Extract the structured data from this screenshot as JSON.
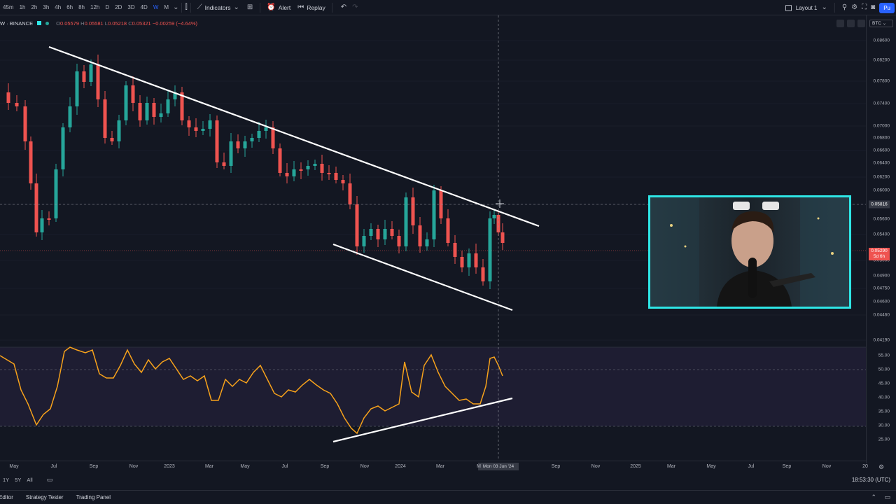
{
  "toolbar": {
    "intervals": [
      "45m",
      "1h",
      "2h",
      "3h",
      "4h",
      "6h",
      "8h",
      "12h",
      "D",
      "2D",
      "3D",
      "4D",
      "W",
      "M"
    ],
    "active_interval": "W",
    "indicators_label": "Indicators",
    "alert_label": "Alert",
    "replay_label": "Replay",
    "layout_label": "Layout 1",
    "publish_label": "Pu"
  },
  "legend": {
    "symbol": "W · BINANCE",
    "open_label": "O",
    "open": "0.05579",
    "high_label": "H",
    "high": "0.05581",
    "low_label": "L",
    "low": "0.05218",
    "close_label": "C",
    "close": "0.05321",
    "change": "−0.00259 (−4.64%)"
  },
  "currency_badge": "BTC",
  "price_axis": {
    "labels": [
      "0.08600",
      "0.08200",
      "0.07800",
      "0.07400",
      "0.07000",
      "0.06800",
      "0.06600",
      "0.06400",
      "0.06200",
      "0.06000",
      "0.05600",
      "0.05400",
      "0.05000",
      "0.04900",
      "0.04750",
      "0.04600",
      "0.04460",
      "0.04190"
    ],
    "crosshair_price": "0.05816",
    "last_price": "0.05290",
    "last_price_countdown": "5d 6h"
  },
  "rsi_axis": {
    "labels": [
      "55.00",
      "50.00",
      "45.00",
      "40.00",
      "35.00",
      "30.00",
      "25.00"
    ]
  },
  "time_axis": {
    "labels": [
      "May",
      "Jul",
      "Sep",
      "Nov",
      "2023",
      "Mar",
      "May",
      "Jul",
      "Sep",
      "Nov",
      "2024",
      "Mar",
      "M",
      "Sep",
      "Nov",
      "2025",
      "Mar",
      "May",
      "Jul",
      "Sep",
      "Nov",
      "20"
    ],
    "cursor_label": "Mon 03 Jun '24"
  },
  "range_bar": {
    "ranges": [
      "1Y",
      "5Y",
      "All"
    ],
    "clock": "18:53:30 (UTC)"
  },
  "bottom_bar": {
    "tabs": [
      "Editor",
      "Strategy Tester",
      "Trading Panel"
    ]
  },
  "colors": {
    "bull": "#26a69a",
    "bear": "#ef5350",
    "rsi": "#f7a21b",
    "trendline": "#ffffff",
    "rsi_band": "#7e57c2",
    "webcam_border": "#2ee6e6",
    "accent": "#2962ff"
  },
  "icons": {
    "bar-type": "bar-type-icon",
    "indicators": "indicators-icon",
    "templates": "grid-icon",
    "alert": "alarm-clock-icon",
    "replay": "replay-icon",
    "undo": "undo-icon",
    "redo": "redo-icon",
    "settings": "gear-icon",
    "fullscreen": "fullscreen-icon",
    "snapshot": "camera-icon"
  }
}
